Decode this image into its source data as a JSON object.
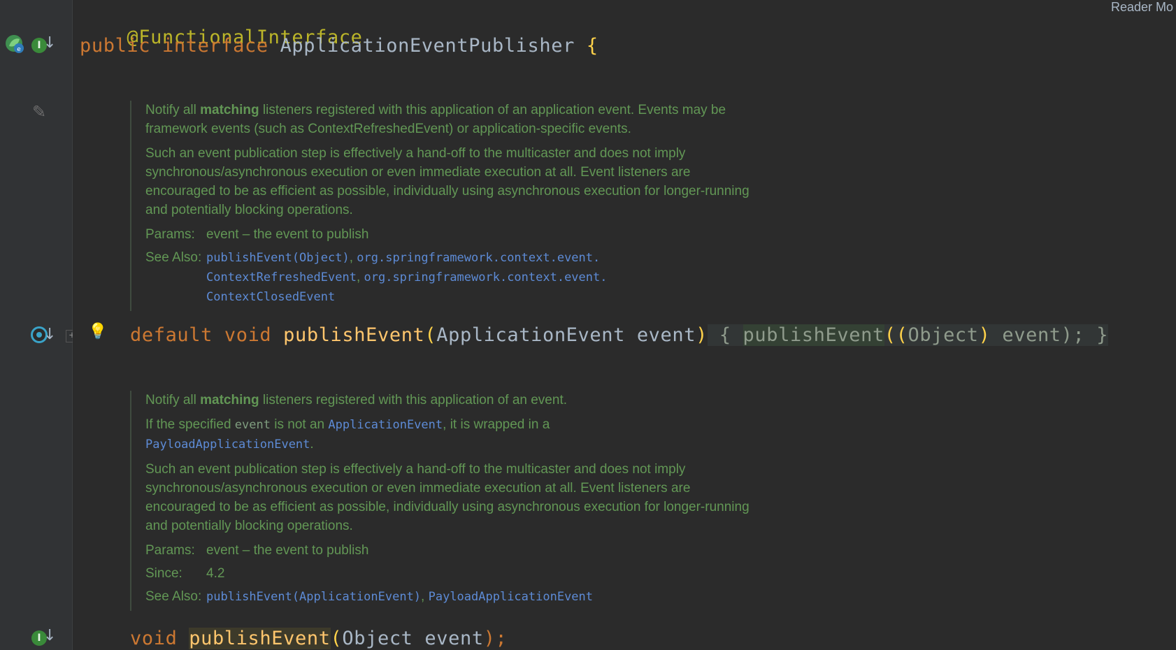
{
  "corner_label": "Reader Mo",
  "code": {
    "annotation": "@FunctionalInterface",
    "decl": {
      "kw1": "public",
      "kw2": "interface",
      "name": "ApplicationEventPublisher",
      "brace": "{"
    },
    "method1": {
      "kw1": "default",
      "kw2": "void",
      "name": "publishEvent",
      "open": "(",
      "param_type": "ApplicationEvent",
      "param_name": "event",
      "close": ")",
      "body_open": "{",
      "call_name": "publishEvent",
      "call_open": "((",
      "cast_type": "Object",
      "cast_close": ")",
      "arg": "event",
      "call_close": ");",
      "body_close": "}"
    },
    "method2": {
      "kw": "void",
      "name": "publishEvent",
      "open": "(",
      "param_type": "Object",
      "param_name": "event",
      "close": ");"
    }
  },
  "doc1": {
    "p1_prefix": "Notify all ",
    "p1_bold": "matching",
    "p1_rest": " listeners registered with this application of an application event. Events may be framework events (such as ContextRefreshedEvent) or application-specific events.",
    "p2": "Such an event publication step is effectively a hand-off to the multicaster and does not imply synchronous/asynchronous execution or even immediate execution at all. Event listeners are encouraged to be as efficient as possible, individually using asynchronous execution for longer-running and potentially blocking operations.",
    "params_tag": "Params:",
    "params_val": "event – the event to publish",
    "see_tag": "See Also:",
    "see_link1": "publishEvent(Object)",
    "see_sep1": ", ",
    "see_link2a": "org.springframework.context.event.",
    "see_link2b": "ContextRefreshedEvent",
    "see_sep2": ", ",
    "see_link3a": "org.springframework.context.event.",
    "see_link3b": "ContextClosedEvent"
  },
  "doc2": {
    "p1_prefix": "Notify all ",
    "p1_bold": "matching",
    "p1_rest": " listeners registered with this application of an event.",
    "p2_a": "If the specified ",
    "p2_code": "event",
    "p2_b": " is not an ",
    "p2_link": "ApplicationEvent",
    "p2_c": ", it is wrapped in a ",
    "p2_link2": "PayloadApplicationEvent",
    "p2_d": ".",
    "p3": "Such an event publication step is effectively a hand-off to the multicaster and does not imply synchronous/asynchronous execution or even immediate execution at all. Event listeners are encouraged to be as efficient as possible, individually using asynchronous execution for longer-running and potentially blocking operations.",
    "params_tag": "Params:",
    "params_val": "event – the event to publish",
    "since_tag": "Since:",
    "since_val": "4.2",
    "see_tag": "See Also:",
    "see_link1": "publishEvent(ApplicationEvent)",
    "see_sep1": ", ",
    "see_link2": "PayloadApplicationEvent"
  },
  "gutter_icons": {
    "line1": [
      "spring-bean-icon",
      "implemented-interface-icon",
      "navigate-down-icon"
    ],
    "doc1": [
      "edit-pencil-icon"
    ],
    "method1": [
      "overridden-method-icon",
      "navigate-down-icon",
      "fold-toggle-icon",
      "intention-bulb-icon"
    ],
    "method2": [
      "implemented-method-icon",
      "navigate-down-icon"
    ]
  },
  "colors": {
    "background": "#2b2b2b",
    "gutter": "#313335",
    "keyword": "#cc7832",
    "annotation": "#bbb529",
    "method": "#ffc66d",
    "identifier": "#a9b7c6",
    "doc_text": "#629755",
    "doc_link": "#5d8bd6"
  }
}
